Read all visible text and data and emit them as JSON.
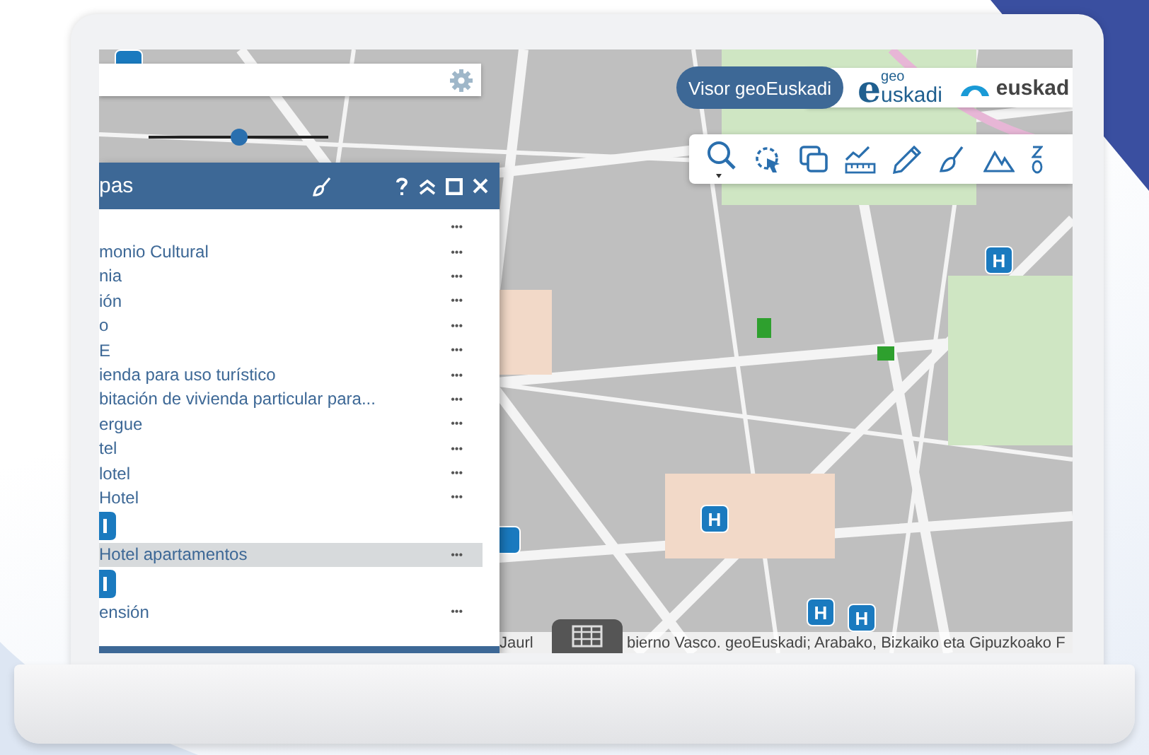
{
  "header": {
    "visor_button": "Visor geoEuskadi",
    "logos": [
      {
        "kind": "geo",
        "mark": "e",
        "superscript": "geo",
        "text": "uskadi"
      },
      {
        "kind": "arc",
        "text": "euskad"
      }
    ]
  },
  "opacity_slider": {
    "level": 0.5
  },
  "layer_panel": {
    "title": "pas",
    "items": [
      {
        "kind": "layer",
        "menu": "•••",
        "selected": false
      },
      {
        "kind": "layer",
        "label": "monio Cultural",
        "menu": "•••",
        "selected": false
      },
      {
        "kind": "layer",
        "label": "nia",
        "menu": "•••",
        "selected": false
      },
      {
        "kind": "layer",
        "label": "ión",
        "menu": "•••",
        "selected": false
      },
      {
        "kind": "layer",
        "label": "o",
        "menu": "•••",
        "selected": false
      },
      {
        "kind": "layer",
        "label": "E",
        "menu": "•••",
        "selected": false
      },
      {
        "kind": "layer",
        "label": "ienda para uso turístico",
        "menu": "•••",
        "selected": false
      },
      {
        "kind": "layer",
        "label": "bitación de vivienda particular para...",
        "menu": "•••",
        "selected": false
      },
      {
        "kind": "layer",
        "label": "ergue",
        "menu": "•••",
        "selected": false
      },
      {
        "kind": "layer",
        "label": "tel",
        "menu": "•••",
        "selected": false
      },
      {
        "kind": "layer",
        "label": "lotel",
        "menu": "•••",
        "selected": false
      },
      {
        "kind": "layer",
        "label": "Hotel",
        "menu": "•••",
        "selected": false
      },
      {
        "kind": "marker"
      },
      {
        "kind": "layer",
        "label": "Hotel apartamentos",
        "menu": "•••",
        "selected": true
      },
      {
        "kind": "marker"
      },
      {
        "kind": "layer",
        "label": "ensión",
        "menu": "•••",
        "selected": false
      }
    ]
  },
  "map": {
    "markers": [
      {
        "label": "H"
      },
      {
        "label": "H"
      },
      {
        "label": "H"
      },
      {
        "label": "H"
      }
    ],
    "attribution": [
      "Jaurl",
      "bierno Vasco. geoEuskadi; Arabako, Bizkaiko eta Gipuzkoako F"
    ]
  }
}
